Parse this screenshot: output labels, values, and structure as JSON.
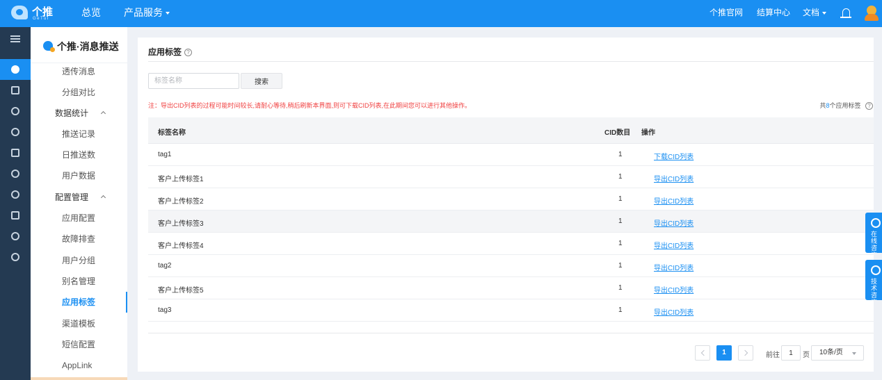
{
  "header": {
    "logo_name": "个推",
    "logo_sub": "GeTuI",
    "nav": [
      {
        "label": "总览"
      },
      {
        "label": "产品服务"
      }
    ],
    "right_links": [
      {
        "label": "个推官网"
      },
      {
        "label": "结算中心"
      },
      {
        "label": "文档"
      }
    ],
    "icons": [
      "bell-icon",
      "avatar-icon"
    ]
  },
  "sidebar": {
    "title": "个推·消息推送",
    "items": [
      {
        "label": "透传消息",
        "type": "item"
      },
      {
        "label": "分组对比",
        "type": "item"
      },
      {
        "label": "数据统计",
        "type": "group"
      },
      {
        "label": "推送记录",
        "type": "item"
      },
      {
        "label": "日推送数",
        "type": "item"
      },
      {
        "label": "用户数据",
        "type": "item"
      },
      {
        "label": "配置管理",
        "type": "group"
      },
      {
        "label": "应用配置",
        "type": "item"
      },
      {
        "label": "故障排查",
        "type": "item"
      },
      {
        "label": "用户分组",
        "type": "item"
      },
      {
        "label": "别名管理",
        "type": "item"
      },
      {
        "label": "应用标签",
        "type": "item",
        "active": true
      },
      {
        "label": "渠道模板",
        "type": "item"
      },
      {
        "label": "短信配置",
        "type": "item"
      },
      {
        "label": "AppLink",
        "type": "item"
      }
    ]
  },
  "page": {
    "title": "应用标签",
    "help_glyph": "?",
    "search_placeholder": "标签名称",
    "search_button": "搜索",
    "notice": "注：导出CID列表的过程可能时间较长,请耐心等待,稍后刷新本界面,则可下载CID列表,在此期间您可以进行其他操作。",
    "count_prefix": "共",
    "count_value": "8",
    "count_suffix": "个应用标签"
  },
  "table": {
    "columns": [
      "标签名称",
      "CID数目",
      "操作"
    ],
    "rows": [
      {
        "name": "tag1",
        "cid": "1",
        "action": "下载CID列表"
      },
      {
        "name": "客户上传标签1",
        "cid": "1",
        "action": "导出CID列表"
      },
      {
        "name": "客户上传标签2",
        "cid": "1",
        "action": "导出CID列表"
      },
      {
        "name": "客户上传标签3",
        "cid": "1",
        "action": "导出CID列表"
      },
      {
        "name": "客户上传标签4",
        "cid": "1",
        "action": "导出CID列表"
      },
      {
        "name": "tag2",
        "cid": "1",
        "action": "导出CID列表"
      },
      {
        "name": "客户上传标签5",
        "cid": "1",
        "action": "导出CID列表"
      },
      {
        "name": "tag3",
        "cid": "1",
        "action": "导出CID列表"
      }
    ]
  },
  "pagination": {
    "current_page": "1",
    "goto_prefix": "前往",
    "goto_value": "1",
    "goto_suffix": "页",
    "page_size": "10条/页"
  },
  "floating": [
    {
      "label": "在线咨询"
    },
    {
      "label": "技术咨询"
    }
  ],
  "colors": {
    "primary": "#1a8ff2",
    "rail": "#243a52",
    "notice": "#f04040"
  }
}
